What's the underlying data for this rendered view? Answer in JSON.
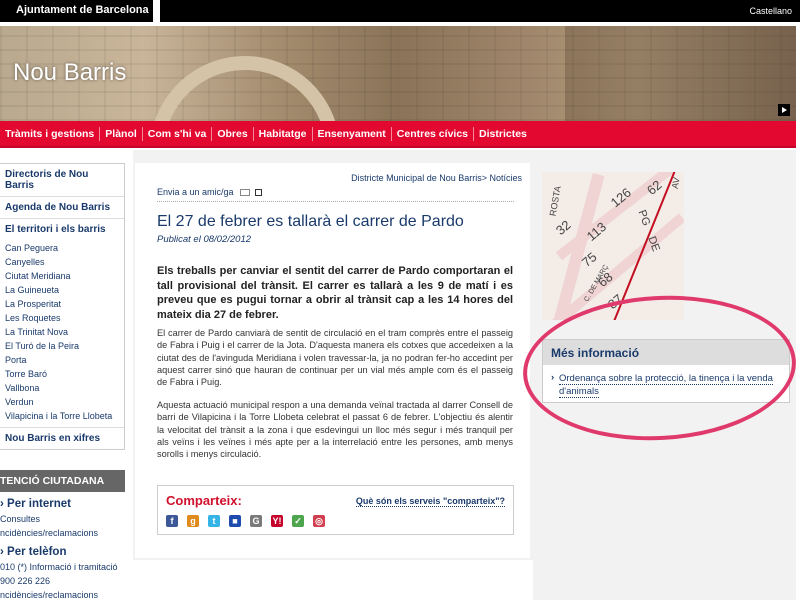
{
  "topbar": {
    "org": "Ajuntament de Barcelona",
    "lang": "Castellano"
  },
  "banner": {
    "title": "Nou Barris"
  },
  "nav": {
    "items": [
      "Tràmits i gestions",
      "Plànol",
      "Com s'hi va",
      "Obres",
      "Habitatge",
      "Ensenyament",
      "Centres cívics",
      "Districtes"
    ]
  },
  "sidebar": {
    "directoris": "Directoris de Nou Barris",
    "agenda": "Agenda de Nou Barris",
    "territori": "El territori i els barris",
    "barris": [
      "Can Peguera",
      "Canyelles",
      "Ciutat Meridiana",
      "La Guineueta",
      "La Prosperitat",
      "Les Roquetes",
      "La Trinitat Nova",
      "El Turó de la Peira",
      "Porta",
      "Torre Baró",
      "Vallbona",
      "Verdun",
      "Vilapicina i la Torre Llobeta"
    ],
    "xifres": "Nou Barris en xifres",
    "atencio": "TENCIÓ CIUTADANA",
    "internet": "Per internet",
    "internet_links": [
      "Consultes",
      "ncidències/reclamacions"
    ],
    "telefon": "Per telèfon",
    "telefon_links": [
      "010 (*) Informació i tramitació",
      "900 226 226",
      "ncidències/reclamacions"
    ]
  },
  "article": {
    "crumb_a": "Districte Municipal de Nou Barris",
    "crumb_b": "Notícies",
    "envia": "Envia a un amic/ga",
    "headline": "El 27 de febrer es tallarà el carrer de Pardo",
    "pubdate": "Publicat el 08/02/2012",
    "lead": "Els treballs per canviar el sentit del carrer de Pardo comportaran el tall provisional del trànsit. El carrer es tallarà a les 9 de matí i es preveu que es pugui tornar a obrir al trànsit cap a les 14 hores del mateix dia 27 de febrer.",
    "p1": "El carrer de Pardo canviarà de sentit de circulació en el tram comprès entre el passeig de Fabra i Puig i el carrer de la Jota. D'aquesta manera els cotxes que accedeixen a la ciutat des de l'avinguda Meridiana i volen travessar-la, ja no podran fer-ho accedint per aquest carrer sinó que hauran de continuar per un vial més ample com és el passeig de Fabra i Puig.",
    "p2": "Aquesta actuació municipal respon a una demanda veïnal tractada al darrer Consell de barri de Vilapicina i la Torre Llobeta celebrat el passat 6 de febrer. L'objectiu és alentir la velocitat del trànsit a la zona i que esdevingui un lloc més segur i més tranquil per als veïns i les veïnes i més apte per a la interrelació entre les persones, amb menys sorolls i menys circulació."
  },
  "share": {
    "label": "Comparteix:",
    "question": "Què són els serveis \"comparteix\"?",
    "icons": [
      {
        "name": "facebook-icon",
        "glyph": "f",
        "color": "#3b5998"
      },
      {
        "name": "google-buzz-icon",
        "glyph": "g",
        "color": "#e08a1b"
      },
      {
        "name": "twitter-icon",
        "glyph": "t",
        "color": "#33b3e6"
      },
      {
        "name": "delicious-icon",
        "glyph": "■",
        "color": "#1e4cae"
      },
      {
        "name": "google-icon",
        "glyph": "G",
        "color": "#7a7a7a"
      },
      {
        "name": "yahoo-icon",
        "glyph": "Y!",
        "color": "#c4002b"
      },
      {
        "name": "meneame-icon",
        "glyph": "✓",
        "color": "#4da64d"
      },
      {
        "name": "generic-share-icon",
        "glyph": "◎",
        "color": "#d04050"
      }
    ]
  },
  "map": {
    "labels": [
      "126",
      "62",
      "113",
      "32",
      "75",
      "68",
      "87",
      "PG",
      "DE",
      "C. DE MARÇ",
      "ROSTA",
      "AV"
    ]
  },
  "mes": {
    "title": "Més informació",
    "link": "Ordenança sobre la protecció, la tinença i la venda d'animals"
  }
}
